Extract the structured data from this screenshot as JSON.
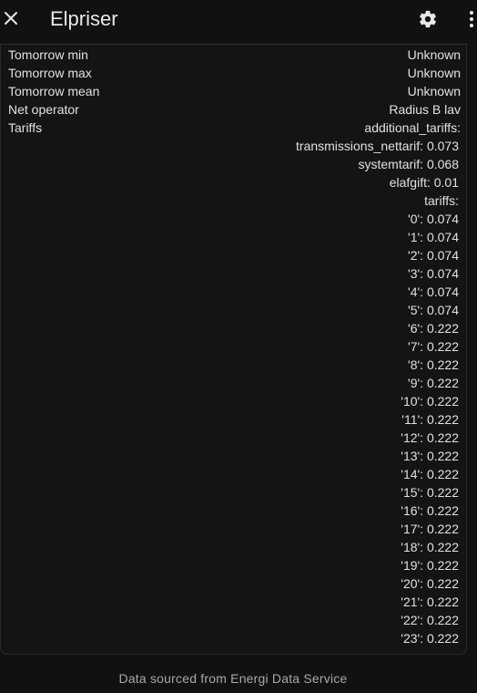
{
  "header": {
    "title": "Elpriser",
    "close_icon": "close-icon",
    "settings_icon": "gear-icon",
    "more_icon": "more-vertical-icon"
  },
  "attributes": [
    {
      "key": "Tomorrow min",
      "value": "Unknown"
    },
    {
      "key": "Tomorrow max",
      "value": "Unknown"
    },
    {
      "key": "Tomorrow mean",
      "value": "Unknown"
    },
    {
      "key": "Net operator",
      "value": "Radius B lav"
    },
    {
      "key": "Tariffs",
      "value": "additional_tariffs:"
    }
  ],
  "tariff_lines": [
    "transmissions_nettarif: 0.073",
    "systemtarif: 0.068",
    "elafgift: 0.01",
    "tariffs:",
    "'0': 0.074",
    "'1': 0.074",
    "'2': 0.074",
    "'3': 0.074",
    "'4': 0.074",
    "'5': 0.074",
    "'6': 0.222",
    "'7': 0.222",
    "'8': 0.222",
    "'9': 0.222",
    "'10': 0.222",
    "'11': 0.222",
    "'12': 0.222",
    "'13': 0.222",
    "'14': 0.222",
    "'15': 0.222",
    "'16': 0.222",
    "'17': 0.222",
    "'18': 0.222",
    "'19': 0.222",
    "'20': 0.222",
    "'21': 0.222",
    "'22': 0.222",
    "'23': 0.222"
  ],
  "footer": {
    "text": "Data sourced from Energi Data Service"
  },
  "colors": {
    "background": "#111111",
    "text": "#e1e1e1",
    "muted_text": "#a8a8a8",
    "border": "#2a2a2a"
  }
}
